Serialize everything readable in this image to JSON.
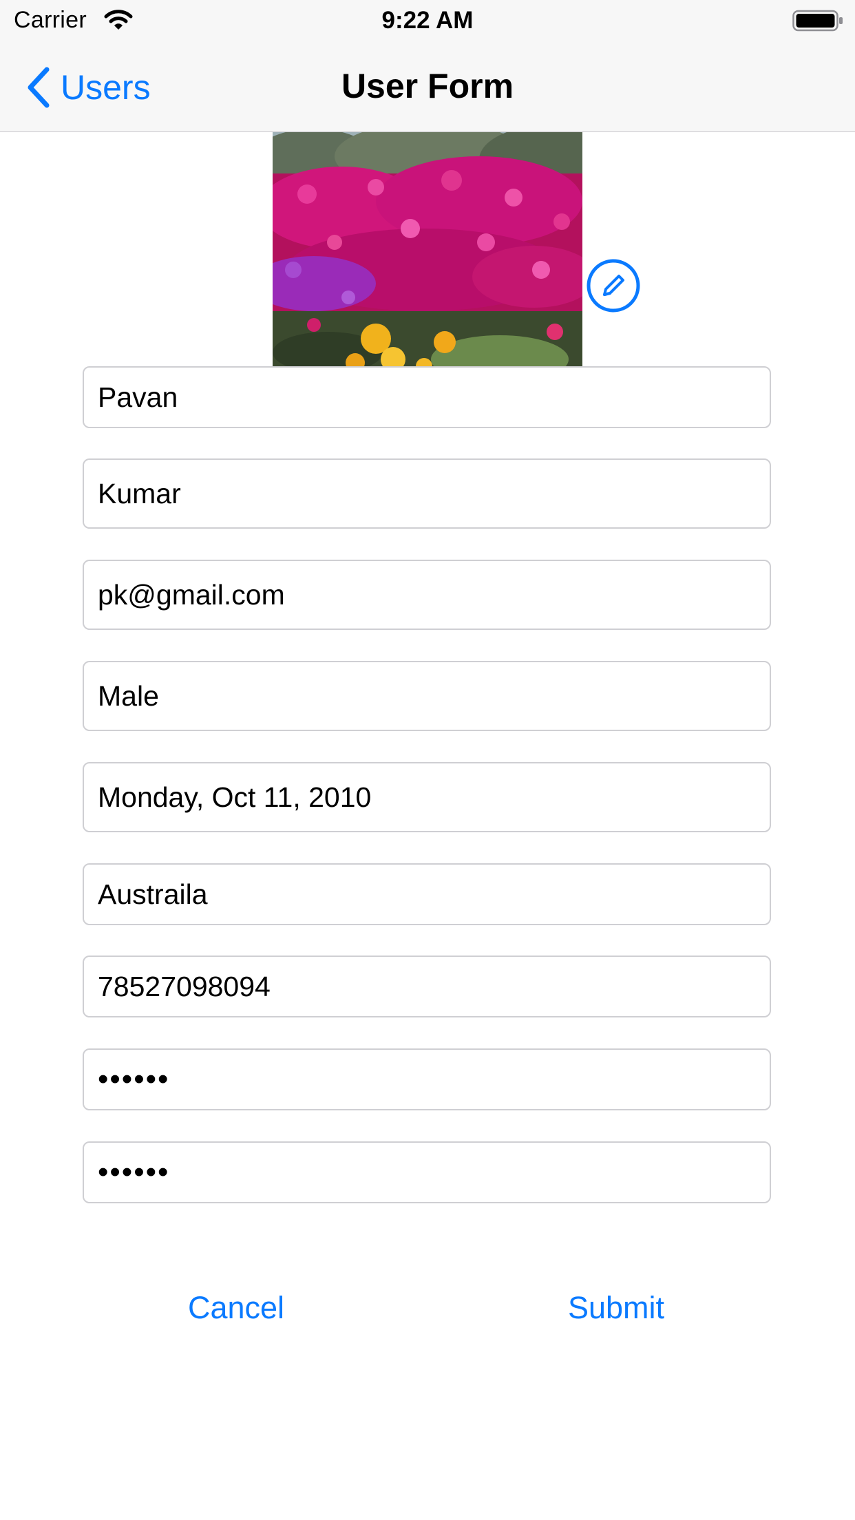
{
  "status_bar": {
    "carrier": "Carrier",
    "time": "9:22 AM"
  },
  "nav": {
    "back_label": "Users",
    "title": "User Form"
  },
  "profile": {
    "photo_icon": "flower-field-photo",
    "edit_icon": "pencil-circle-icon"
  },
  "form": {
    "first_name": "Pavan",
    "last_name": "Kumar",
    "email": "pk@gmail.com",
    "gender": "Male",
    "date_of_birth": "Monday, Oct 11, 2010",
    "country": "Austraila",
    "phone": "78527098094",
    "password": "••••••",
    "confirm_password": "••••••"
  },
  "actions": {
    "cancel": "Cancel",
    "submit": "Submit"
  },
  "colors": {
    "accent": "#0a7aff",
    "field_border": "#cfcfd3",
    "bar_background": "#f7f7f7"
  }
}
